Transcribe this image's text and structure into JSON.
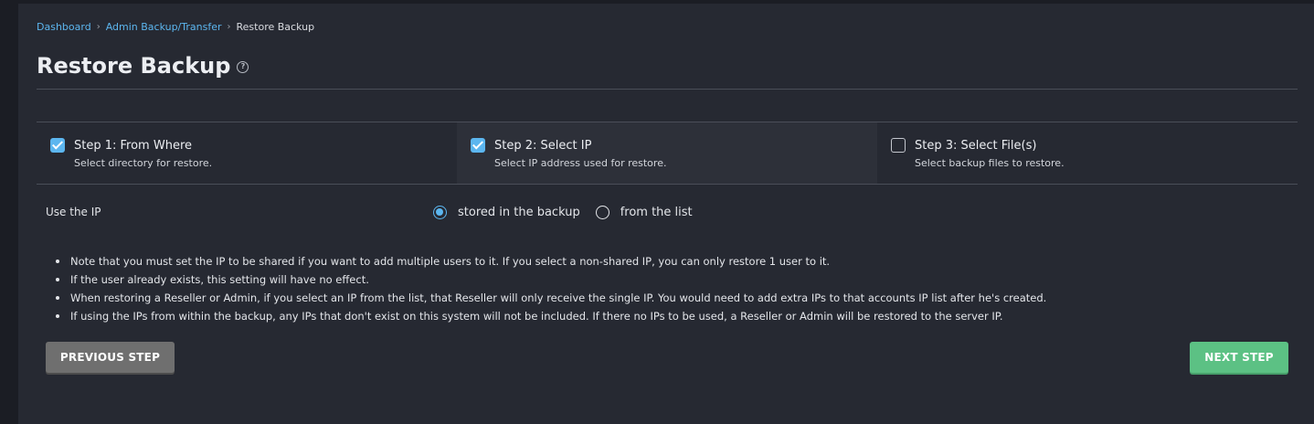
{
  "breadcrumb": {
    "items": [
      "Dashboard",
      "Admin Backup/Transfer"
    ],
    "current": "Restore Backup",
    "separator": "›"
  },
  "page": {
    "title": "Restore Backup",
    "help_icon": "?"
  },
  "steps": [
    {
      "title": "Step 1: From Where",
      "description": "Select directory for restore.",
      "checked": true
    },
    {
      "title": "Step 2: Select IP",
      "description": "Select IP address used for restore.",
      "checked": true,
      "active": true
    },
    {
      "title": "Step 3: Select File(s)",
      "description": "Select backup files to restore.",
      "checked": false
    }
  ],
  "ip_setting": {
    "label": "Use the IP",
    "options": [
      "stored in the backup",
      "from the list"
    ],
    "selected": "stored in the backup"
  },
  "notes": [
    "Note that you must set the IP to be shared if you want to add multiple users to it. If you select a non-shared IP, you can only restore 1 user to it.",
    "If the user already exists, this setting will have no effect.",
    "When restoring a Reseller or Admin, if you select an IP from the list, that Reseller will only receive the single IP. You would need to add extra IPs to that accounts IP list after he's created.",
    "If using the IPs from within the backup, any IPs that don't exist on this system will not be included. If there no IPs to be used, a Reseller or Admin will be restored to the server IP."
  ],
  "buttons": {
    "previous": "PREVIOUS STEP",
    "next": "NEXT STEP"
  },
  "colors": {
    "accent": "#5cb6ef",
    "next_button": "#5cc184",
    "previous_button": "#6f6f6f",
    "panel": "#262932",
    "background": "#1b1d24"
  }
}
